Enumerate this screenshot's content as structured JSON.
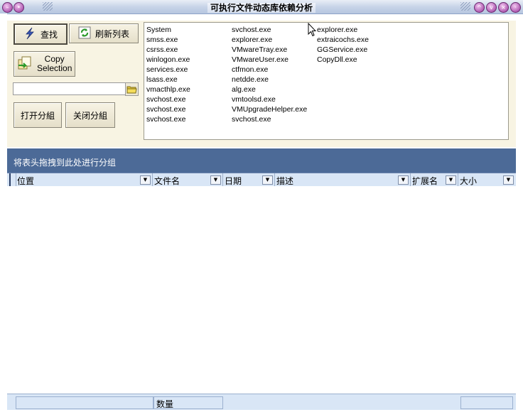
{
  "window": {
    "title": "可执行文件动态库依赖分析"
  },
  "toolbar": {
    "find_label": "查找",
    "refresh_label": "刷新列表",
    "copy_label_1": "Copy",
    "copy_label_2": "Selection",
    "file_path_value": "",
    "open_group_label": "打开分組",
    "close_group_label": "关闭分組"
  },
  "process_list": {
    "col1": [
      "System",
      "smss.exe",
      "csrss.exe",
      "winlogon.exe",
      "services.exe",
      "lsass.exe",
      "vmacthlp.exe",
      "svchost.exe",
      "svchost.exe",
      "svchost.exe"
    ],
    "col2": [
      "svchost.exe",
      "explorer.exe",
      "VMwareTray.exe",
      "VMwareUser.exe",
      "ctfmon.exe",
      "netdde.exe",
      "alg.exe",
      "vmtoolsd.exe",
      "VMUpgradeHelper.exe",
      "svchost.exe"
    ],
    "col3": [
      "explorer.exe",
      "extraicochs.exe",
      "GGService.exe",
      "CopyDll.exe"
    ]
  },
  "grid": {
    "group_hint": "将表头拖拽到此处进行分组",
    "columns": [
      "位置",
      "文件名",
      "日期",
      "描述",
      "扩展名",
      "大小"
    ],
    "footer_count_label": "数量"
  }
}
